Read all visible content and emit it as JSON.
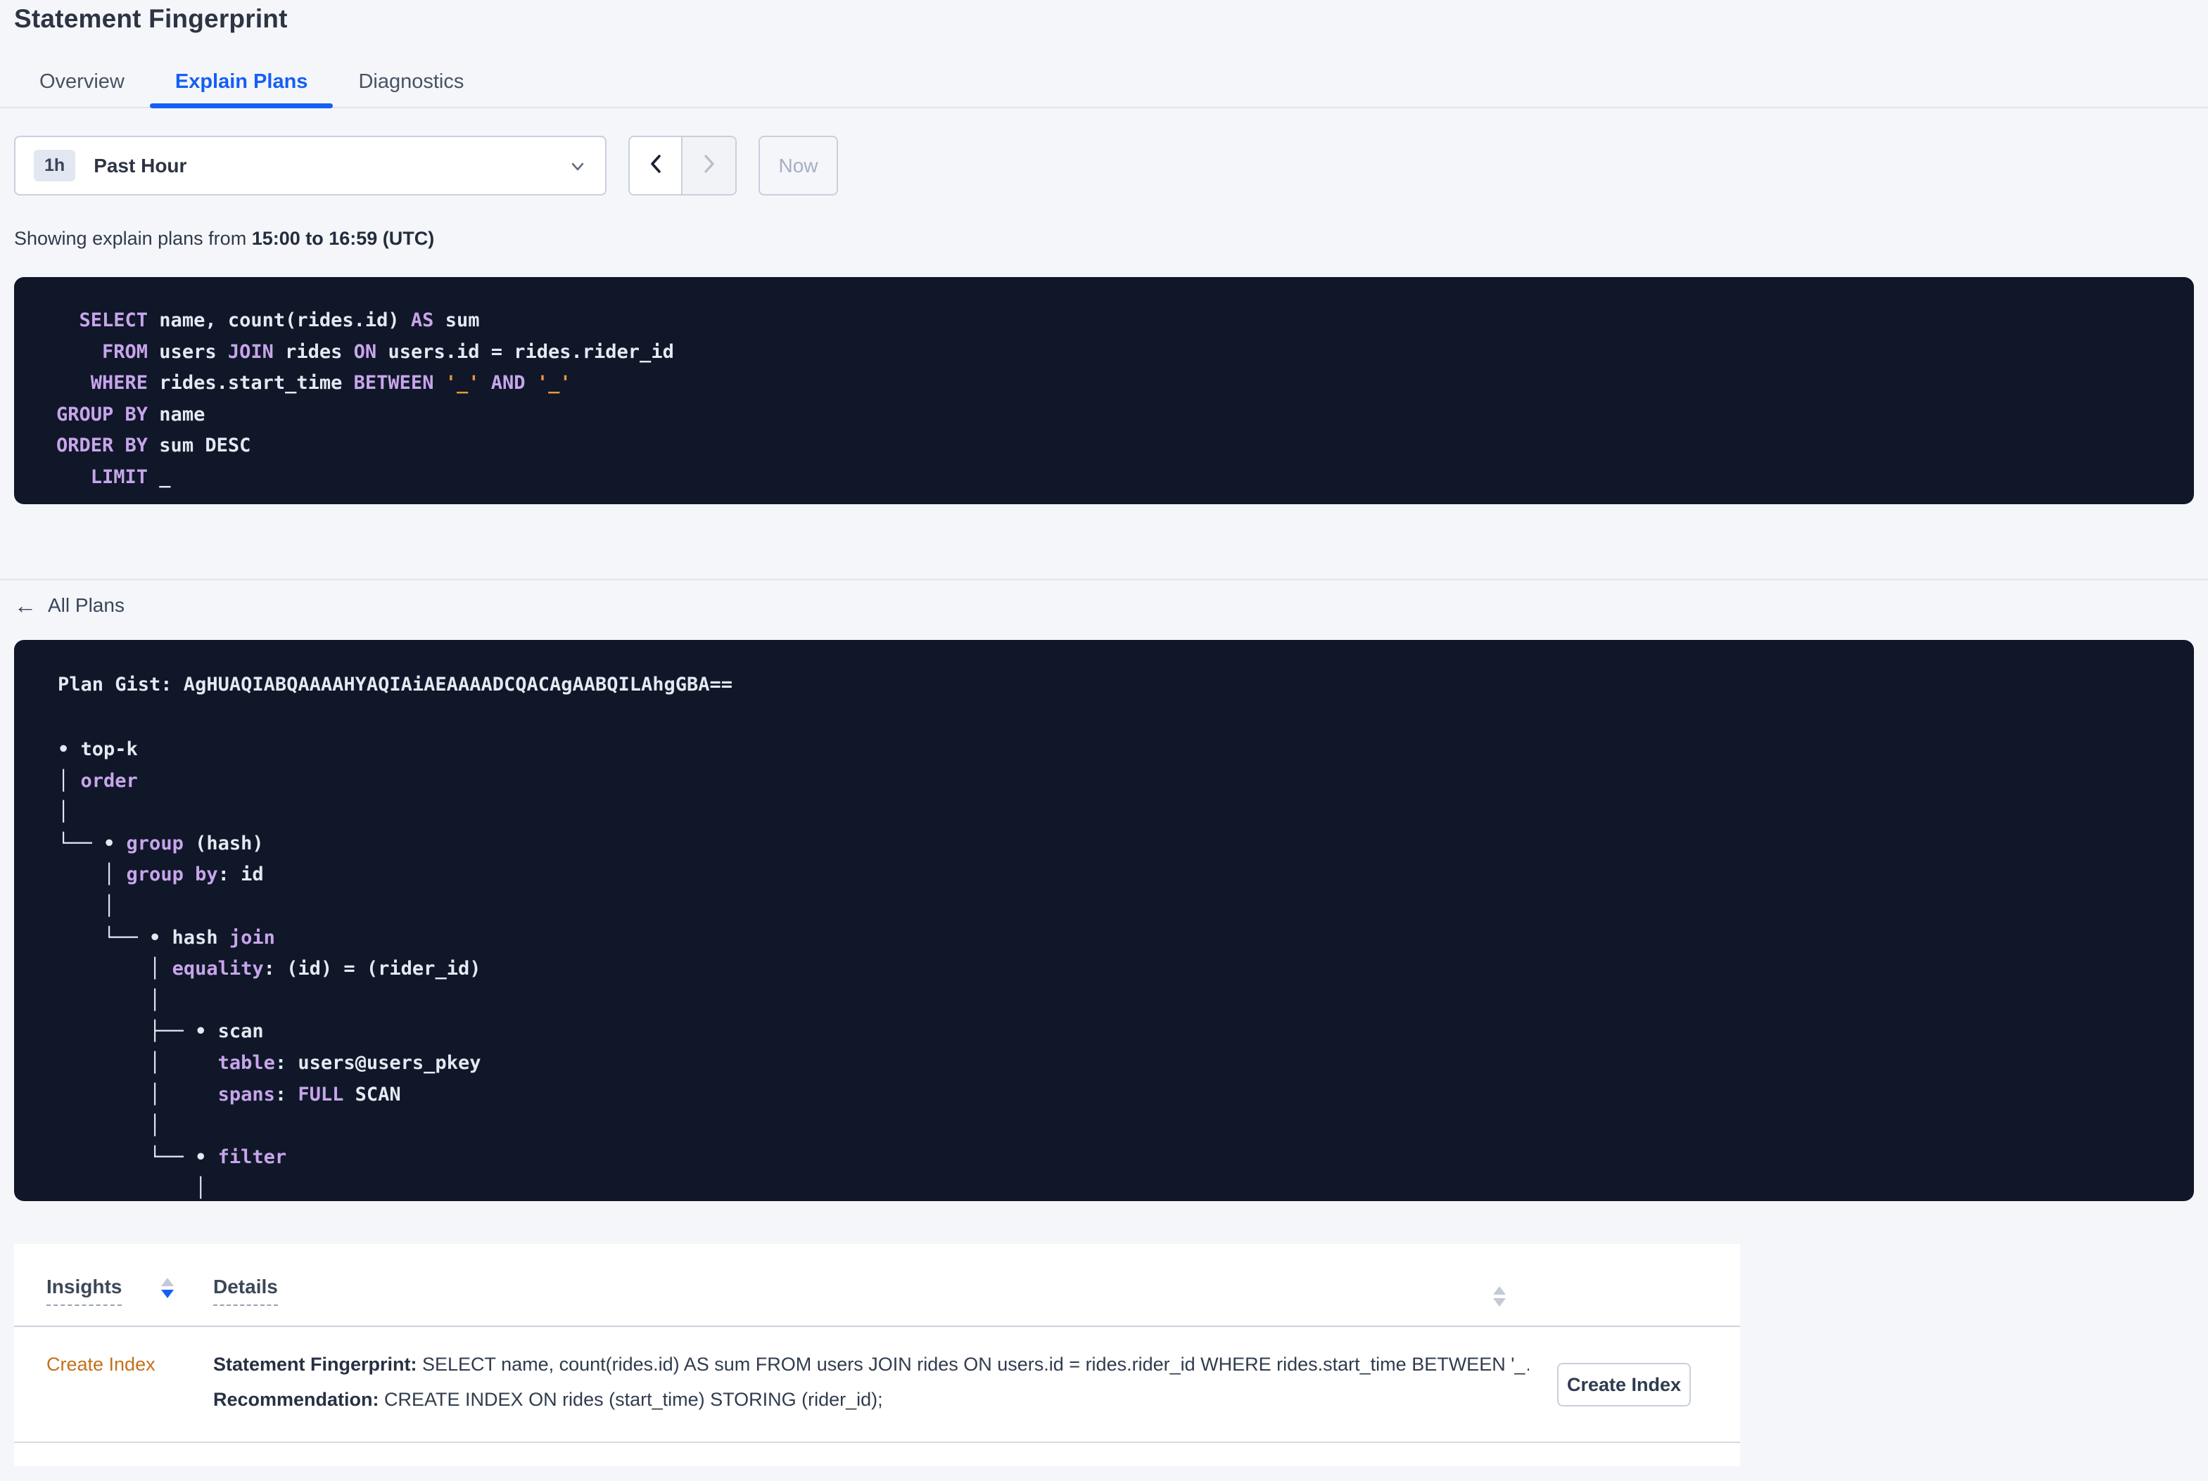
{
  "page": {
    "title": "Statement Fingerprint"
  },
  "tabs": [
    {
      "label": "Overview",
      "active": false
    },
    {
      "label": "Explain Plans",
      "active": true
    },
    {
      "label": "Diagnostics",
      "active": false
    }
  ],
  "time_selector": {
    "badge": "1h",
    "label": "Past Hour",
    "now_label": "Now"
  },
  "showing": {
    "prefix": "Showing explain plans from ",
    "range": "15:00 to 16:59 (UTC)"
  },
  "sql": {
    "lines": [
      [
        [
          "k",
          "  SELECT"
        ],
        [
          "t",
          " name, count(rides.id) "
        ],
        [
          "k",
          "AS"
        ],
        [
          "t",
          " sum"
        ]
      ],
      [
        [
          "k",
          "    FROM"
        ],
        [
          "t",
          " users "
        ],
        [
          "k",
          "JOIN"
        ],
        [
          "t",
          " rides "
        ],
        [
          "k",
          "ON"
        ],
        [
          "t",
          " users.id = rides.rider_id"
        ]
      ],
      [
        [
          "k",
          "   WHERE"
        ],
        [
          "t",
          " rides.start_time "
        ],
        [
          "k",
          "BETWEEN"
        ],
        [
          "t",
          " "
        ],
        [
          "p",
          "'_'"
        ],
        [
          "t",
          " "
        ],
        [
          "k",
          "AND"
        ],
        [
          "t",
          " "
        ],
        [
          "p",
          "'_'"
        ]
      ],
      [
        [
          "k",
          "GROUP BY"
        ],
        [
          "t",
          " name"
        ]
      ],
      [
        [
          "k",
          "ORDER BY"
        ],
        [
          "t",
          " sum DESC"
        ]
      ],
      [
        [
          "k",
          "   LIMIT"
        ],
        [
          "t",
          " _"
        ]
      ]
    ]
  },
  "all_plans": {
    "label": "All Plans",
    "arrow": "←"
  },
  "plan": {
    "gist_line": "Plan Gist: AgHUAQIABQAAAAHYAQIAiAEAAAADCQACAgAABQILAhgGBA==",
    "tree_lines": [
      [
        [
          "t",
          "• top-k"
        ]
      ],
      [
        [
          "t",
          "│ "
        ],
        [
          "k",
          "order"
        ]
      ],
      [
        [
          "t",
          "│"
        ]
      ],
      [
        [
          "t",
          "└── • "
        ],
        [
          "k",
          "group"
        ],
        [
          "t",
          " (hash)"
        ]
      ],
      [
        [
          "t",
          "    │ "
        ],
        [
          "k",
          "group by"
        ],
        [
          "t",
          ": id"
        ]
      ],
      [
        [
          "t",
          "    │"
        ]
      ],
      [
        [
          "t",
          "    └── • hash "
        ],
        [
          "k",
          "join"
        ]
      ],
      [
        [
          "t",
          "        │ "
        ],
        [
          "k",
          "equality"
        ],
        [
          "t",
          ": (id) = (rider_id)"
        ]
      ],
      [
        [
          "t",
          "        │"
        ]
      ],
      [
        [
          "t",
          "        ├── • scan"
        ]
      ],
      [
        [
          "t",
          "        │     "
        ],
        [
          "k",
          "table"
        ],
        [
          "t",
          ": users@users_pkey"
        ]
      ],
      [
        [
          "t",
          "        │     "
        ],
        [
          "k",
          "spans"
        ],
        [
          "t",
          ": "
        ],
        [
          "k",
          "FULL"
        ],
        [
          "t",
          " SCAN"
        ]
      ],
      [
        [
          "t",
          "        │"
        ]
      ],
      [
        [
          "t",
          "        └── • "
        ],
        [
          "k",
          "filter"
        ]
      ],
      [
        [
          "t",
          "            │"
        ]
      ]
    ]
  },
  "insights_table": {
    "headers": {
      "insights": "Insights",
      "details": "Details"
    },
    "row": {
      "insight": "Create Index",
      "fingerprint_label": "Statement Fingerprint:",
      "fingerprint": " SELECT name, count(rides.id) AS sum FROM users JOIN rides ON users.id = rides.rider_id WHERE rides.start_time BETWEEN '_…",
      "recommendation_label": "Recommendation:",
      "recommendation": " CREATE INDEX ON rides (start_time) STORING (rider_id);",
      "button": "Create Index"
    }
  },
  "colors": {
    "accent_blue": "#145ff5",
    "insight_orange": "#c4701c",
    "keyword_purple": "#c8a5eb",
    "placeholder_orange": "#e6963c",
    "panel_bg": "#0f1729"
  }
}
